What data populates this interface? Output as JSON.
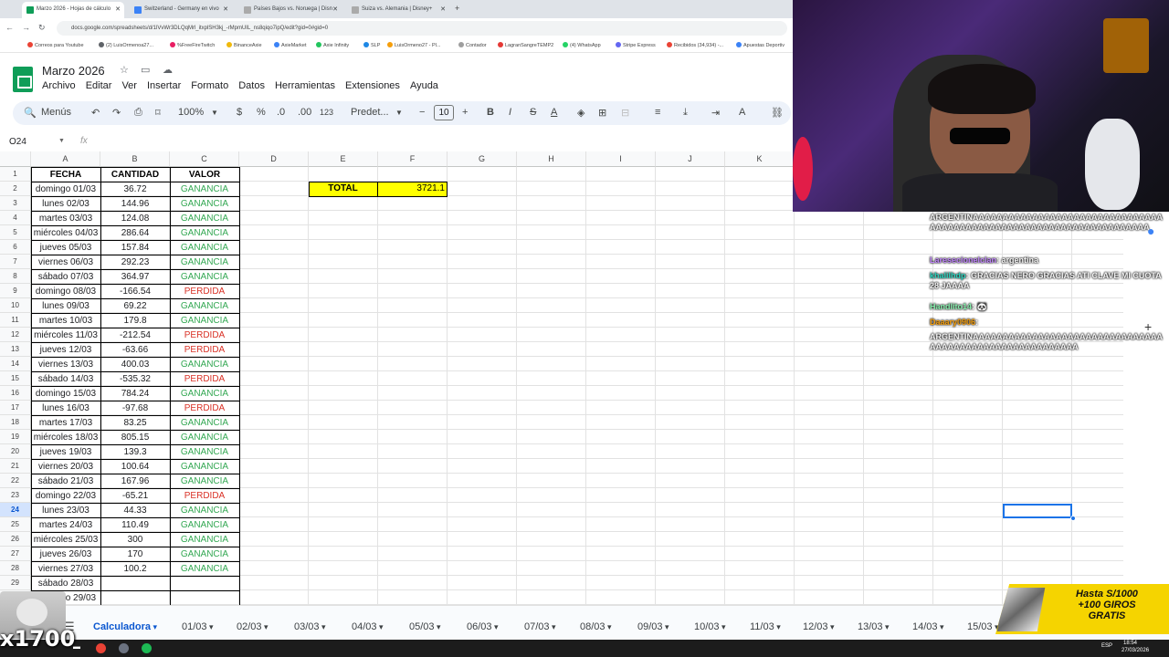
{
  "browser": {
    "tabs": [
      {
        "label": "Marzo 2026 - Hojas de cálculo",
        "color": "#0f9d58",
        "active": true
      },
      {
        "label": "Switzerland - Germany en vivo",
        "color": "#3b82f6",
        "active": false
      },
      {
        "label": "Países Bajos vs. Noruega | Disn",
        "color": "#aaaaaa",
        "active": false
      },
      {
        "label": "Suiza vs. Alemania | Disney+",
        "color": "#aaaaaa",
        "active": false
      }
    ],
    "new_tab": "+",
    "url": "docs.google.com/spreadsheets/d/1lVvWr3DLQqMrl_itxplSH3kj_-rMpmUIL_ns8qiqo7ipQ/edit?gid=0#gid=0",
    "bookmarks": [
      "Correos para Youtube",
      "(2) LuisOrmenoa27...",
      "%FreeFireTwitch",
      "BinanceAxie",
      "AxieMarket",
      "Axie Infinity",
      "SLP",
      "LuisOrmeno27 - Pl...",
      "Contador",
      "LagranSangreTEMP2",
      "(4) WhatsApp",
      "Stripe Express",
      "Recibidos (34,934) -...",
      "Apuestas Deportiv"
    ]
  },
  "sheets": {
    "title": "Marzo 2026",
    "menu": [
      "Archivo",
      "Editar",
      "Ver",
      "Insertar",
      "Formato",
      "Datos",
      "Herramientas",
      "Extensiones",
      "Ayuda"
    ],
    "toolbar": {
      "search": "Menús",
      "zoom": "100%",
      "currency": "$",
      "percent": "%",
      "dec_less": ".0",
      "dec_more": ".00",
      "format": "123",
      "font": "Predet...",
      "font_size": "10",
      "bold": "B",
      "italic": "I",
      "strike": "S",
      "text_color": "A"
    },
    "name_box": "O24",
    "fx": "fx",
    "columns": [
      "A",
      "B",
      "C",
      "D",
      "E",
      "F",
      "G",
      "H",
      "I",
      "J",
      "K"
    ],
    "header": {
      "fecha": "FECHA",
      "cantidad": "CANTIDAD",
      "valor": "VALOR"
    },
    "total_label": "TOTAL",
    "total_value": "3721.1",
    "rows": [
      {
        "fecha": "domingo 01/03",
        "cantidad": "36.72",
        "valor": "GANANCIA"
      },
      {
        "fecha": "lunes 02/03",
        "cantidad": "144.96",
        "valor": "GANANCIA"
      },
      {
        "fecha": "martes 03/03",
        "cantidad": "124.08",
        "valor": "GANANCIA"
      },
      {
        "fecha": "miércoles 04/03",
        "cantidad": "286.64",
        "valor": "GANANCIA"
      },
      {
        "fecha": "jueves 05/03",
        "cantidad": "157.84",
        "valor": "GANANCIA"
      },
      {
        "fecha": "viernes 06/03",
        "cantidad": "292.23",
        "valor": "GANANCIA"
      },
      {
        "fecha": "sábado 07/03",
        "cantidad": "364.97",
        "valor": "GANANCIA"
      },
      {
        "fecha": "domingo 08/03",
        "cantidad": "-166.54",
        "valor": "PERDIDA"
      },
      {
        "fecha": "lunes 09/03",
        "cantidad": "69.22",
        "valor": "GANANCIA"
      },
      {
        "fecha": "martes 10/03",
        "cantidad": "179.8",
        "valor": "GANANCIA"
      },
      {
        "fecha": "miércoles 11/03",
        "cantidad": "-212.54",
        "valor": "PERDIDA"
      },
      {
        "fecha": "jueves 12/03",
        "cantidad": "-63.66",
        "valor": "PERDIDA"
      },
      {
        "fecha": "viernes 13/03",
        "cantidad": "400.03",
        "valor": "GANANCIA"
      },
      {
        "fecha": "sábado 14/03",
        "cantidad": "-535.32",
        "valor": "PERDIDA"
      },
      {
        "fecha": "domingo 15/03",
        "cantidad": "784.24",
        "valor": "GANANCIA"
      },
      {
        "fecha": "lunes 16/03",
        "cantidad": "-97.68",
        "valor": "PERDIDA"
      },
      {
        "fecha": "martes 17/03",
        "cantidad": "83.25",
        "valor": "GANANCIA"
      },
      {
        "fecha": "miércoles 18/03",
        "cantidad": "805.15",
        "valor": "GANANCIA"
      },
      {
        "fecha": "jueves 19/03",
        "cantidad": "139.3",
        "valor": "GANANCIA"
      },
      {
        "fecha": "viernes 20/03",
        "cantidad": "100.64",
        "valor": "GANANCIA"
      },
      {
        "fecha": "sábado 21/03",
        "cantidad": "167.96",
        "valor": "GANANCIA"
      },
      {
        "fecha": "domingo 22/03",
        "cantidad": "-65.21",
        "valor": "PERDIDA"
      },
      {
        "fecha": "lunes 23/03",
        "cantidad": "44.33",
        "valor": "GANANCIA"
      },
      {
        "fecha": "martes 24/03",
        "cantidad": "110.49",
        "valor": "GANANCIA"
      },
      {
        "fecha": "miércoles 25/03",
        "cantidad": "300",
        "valor": "GANANCIA"
      },
      {
        "fecha": "jueves 26/03",
        "cantidad": "170",
        "valor": "GANANCIA"
      },
      {
        "fecha": "viernes 27/03",
        "cantidad": "100.2",
        "valor": "GANANCIA"
      },
      {
        "fecha": "sábado 28/03",
        "cantidad": "",
        "valor": ""
      },
      {
        "fecha": "domingo 29/03",
        "cantidad": "",
        "valor": ""
      }
    ],
    "selected_row": "24",
    "sheet_tabs": [
      "Calculadora",
      "01/03",
      "02/03",
      "03/03",
      "04/03",
      "05/03",
      "06/03",
      "07/03",
      "08/03",
      "09/03",
      "10/03",
      "11/03",
      "12/03",
      "13/03",
      "14/03",
      "15/03"
    ],
    "active_sheet": "Calculadora"
  },
  "chat": [
    {
      "user": "",
      "text": "ARGENTINAAAAAAAAAAAAAAAAAAAAAAAAAAAAAAAAAAAAAAAAAAAAAAAAAAAAAAAAAAAAAAAAAAAAA",
      "color": "#f4f4f4"
    },
    {
      "user": "Laresecionelclan",
      "text": ": argentina",
      "color": "#c084fc"
    },
    {
      "user": "khalilhdp",
      "text": ": GRACIAS NERO GRACIAS ATI CLAVE MI CUOTA 28 JAAAA",
      "color": "#2dd4bf"
    },
    {
      "user": "Handlito14",
      "text": ": 🐼",
      "color": "#86efac"
    },
    {
      "user": "Daaary0906",
      "text": ":",
      "color": "#f59e0b"
    },
    {
      "user": "",
      "text": "ARGENTINAAAAAAAAAAAAAAAAAAAAAAAAAAAAAAAAAAAAAAAAAAAAAAAAAAAAAAAAA",
      "color": "#f4f4f4"
    }
  ],
  "ad": {
    "line1": "Hasta S/1000",
    "line2": "+100 GIROS",
    "line3": "GRATIS"
  },
  "overlay": {
    "counter": "x1700"
  },
  "taskbar": {
    "lang": "ESP",
    "time": "18:54",
    "date": "27/03/2026"
  }
}
